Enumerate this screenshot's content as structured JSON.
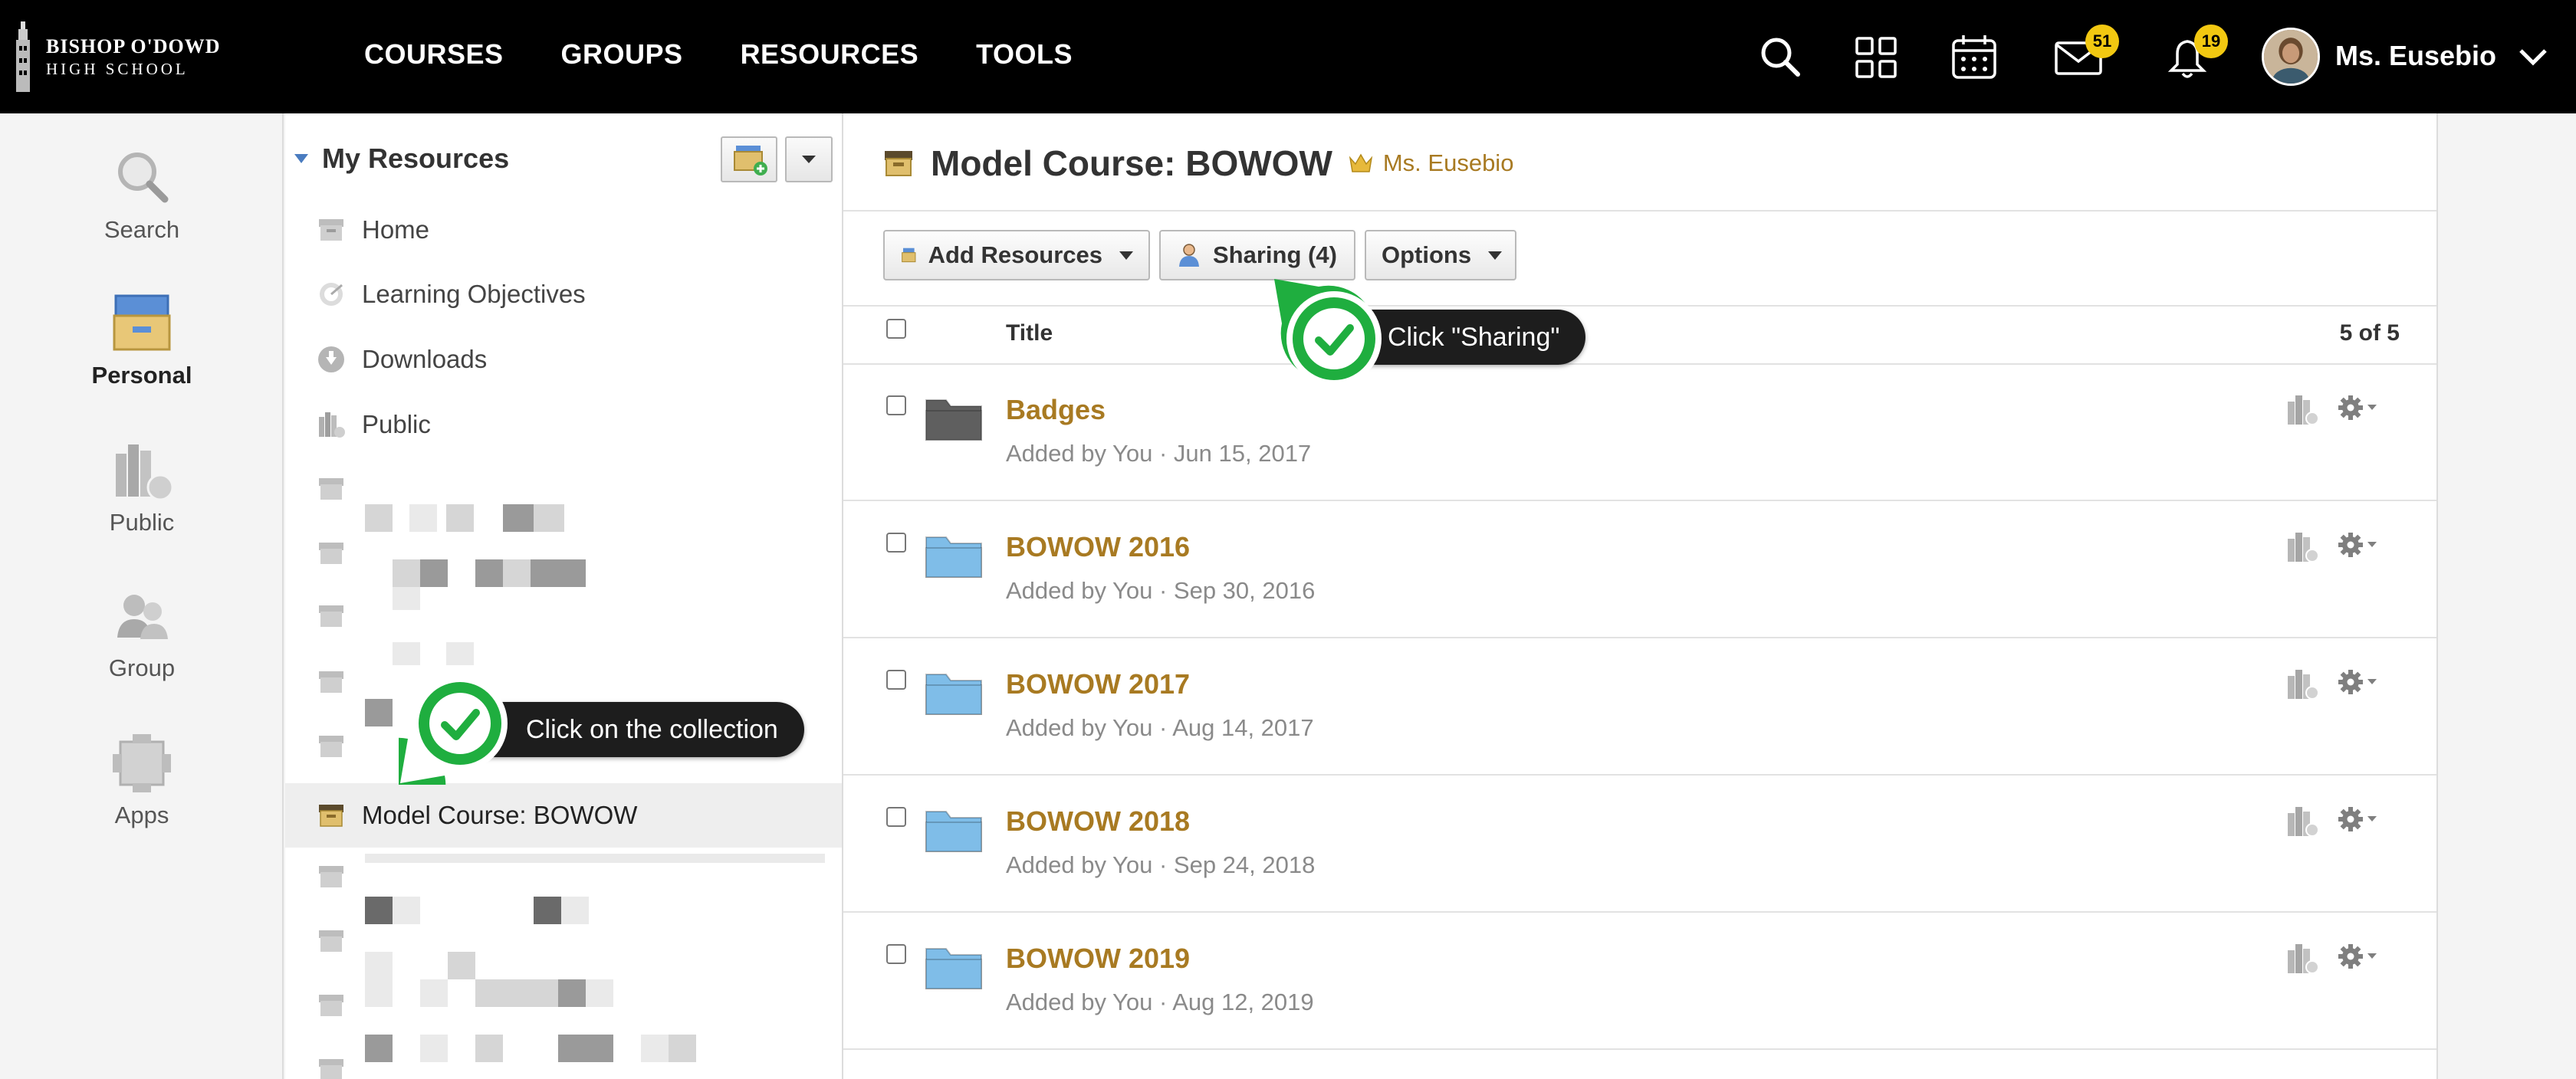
{
  "school": {
    "line1": "BISHOP O'DOWD",
    "line2": "HIGH SCHOOL"
  },
  "topnav": [
    "COURSES",
    "GROUPS",
    "RESOURCES",
    "TOOLS"
  ],
  "badges": {
    "messages": "51",
    "notifications": "19"
  },
  "user": {
    "name": "Ms. Eusebio"
  },
  "rail": {
    "search": "Search",
    "personal": "Personal",
    "public": "Public",
    "group": "Group",
    "apps": "Apps"
  },
  "resources": {
    "title": "My Resources",
    "items": [
      {
        "label": "Home"
      },
      {
        "label": "Learning Objectives"
      },
      {
        "label": "Downloads"
      },
      {
        "label": "Public"
      }
    ],
    "selected": "Model Course: BOWOW"
  },
  "main": {
    "title": "Model Course: BOWOW",
    "owner": "Ms. Eusebio",
    "toolbar": {
      "add": "Add Resources",
      "sharing": "Sharing (4)",
      "options": "Options"
    },
    "column_title": "Title",
    "count": "5 of 5",
    "rows": [
      {
        "title": "Badges",
        "meta": "Added by You · Jun 15, 2017",
        "folder_color": "#5f5f5f"
      },
      {
        "title": "BOWOW 2016",
        "meta": "Added by You · Sep 30, 2016",
        "folder_color": "#7fbde8"
      },
      {
        "title": "BOWOW 2017",
        "meta": "Added by You · Aug 14, 2017",
        "folder_color": "#7fbde8"
      },
      {
        "title": "BOWOW 2018",
        "meta": "Added by You · Sep 24, 2018",
        "folder_color": "#7fbde8"
      },
      {
        "title": "BOWOW 2019",
        "meta": "Added by You · Aug 12, 2019",
        "folder_color": "#7fbde8"
      }
    ]
  },
  "callouts": {
    "sharing": "Click \"Sharing\"",
    "collection": "Click on the collection"
  },
  "colors": {
    "accent": "#a87a22",
    "topbar": "#000000",
    "badge": "#f2c811",
    "marker": "#1fae3f"
  }
}
